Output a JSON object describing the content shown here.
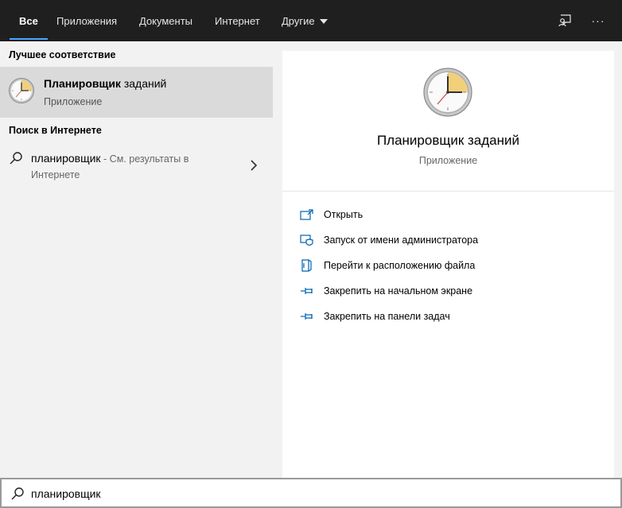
{
  "tabs": [
    {
      "label": "Все",
      "active": true
    },
    {
      "label": "Приложения"
    },
    {
      "label": "Документы"
    },
    {
      "label": "Интернет"
    },
    {
      "label": "Другие"
    }
  ],
  "topbar": {
    "feedback_icon": "feedback-icon",
    "more_icon": "more-icon",
    "more_glyph": "···"
  },
  "best_match": {
    "header": "Лучшее соответствие",
    "title_bold": "Планировщик",
    "title_rest": " заданий",
    "subtitle": "Приложение",
    "icon": "clock-icon"
  },
  "web_search": {
    "header": "Поиск в Интернете",
    "query": "планировщик",
    "suffix": " - См. результаты в",
    "suffix_line2": "Интернете"
  },
  "preview": {
    "title": "Планировщик заданий",
    "subtitle": "Приложение",
    "actions": [
      {
        "label": "Открыть",
        "icon": "open-icon"
      },
      {
        "label": "Запуск от имени администратора",
        "icon": "admin-shield-icon"
      },
      {
        "label": "Перейти к расположению файла",
        "icon": "file-location-icon"
      },
      {
        "label": "Закрепить на начальном экране",
        "icon": "pin-icon"
      },
      {
        "label": "Закрепить на панели задач",
        "icon": "pin-icon"
      }
    ]
  },
  "search": {
    "value": "планировщик"
  },
  "colors": {
    "topbar": "#1f1f1f",
    "accent": "#4aa3ff",
    "selected": "#dadada",
    "action_icon": "#0063b1"
  }
}
